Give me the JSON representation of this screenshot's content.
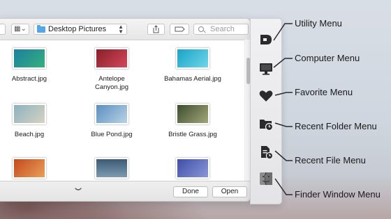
{
  "toolbar": {
    "folder": "Desktop Pictures",
    "search_placeholder": "Search"
  },
  "files": [
    {
      "name": "Abstract.jpg",
      "colors": [
        "#1d7fa0",
        "#35b07d"
      ]
    },
    {
      "name": "Antelope Canyon.jpg",
      "colors": [
        "#8a1f2a",
        "#d2485a"
      ]
    },
    {
      "name": "Bahamas Aerial.jpg",
      "colors": [
        "#1aa3c9",
        "#6fd6e8"
      ]
    },
    {
      "name": "Beach.jpg",
      "colors": [
        "#8cb2c0",
        "#d7d2c2"
      ]
    },
    {
      "name": "Blue Pond.jpg",
      "colors": [
        "#5b8fbf",
        "#b9d2e6"
      ]
    },
    {
      "name": "Bristle Grass.jpg",
      "colors": [
        "#3d4d2e",
        "#a3a77a"
      ]
    },
    {
      "name": "",
      "colors": [
        "#c4491c",
        "#e8a05a"
      ]
    },
    {
      "name": "",
      "colors": [
        "#3d5b74",
        "#7c9bb2"
      ]
    },
    {
      "name": "",
      "colors": [
        "#3e4fa4",
        "#8a96d8"
      ]
    }
  ],
  "footer": {
    "done_label": "Done",
    "open_label": "Open"
  },
  "menus": [
    {
      "label": "Utility Menu",
      "icon": "utility-menu-icon"
    },
    {
      "label": "Computer Menu",
      "icon": "computer-menu-icon"
    },
    {
      "label": "Favorite Menu",
      "icon": "favorite-menu-icon"
    },
    {
      "label": "Recent Folder Menu",
      "icon": "recent-folder-menu-icon"
    },
    {
      "label": "Recent File Menu",
      "icon": "recent-file-menu-icon"
    },
    {
      "label": "Finder Window Menu",
      "icon": "finder-window-menu-icon"
    }
  ]
}
